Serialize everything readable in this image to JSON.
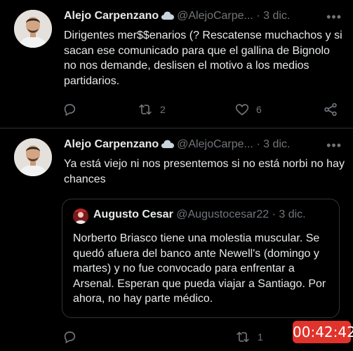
{
  "tweets": [
    {
      "author_name": "Alejo Carpenzano",
      "handle": "@AlejoCarpe...",
      "time": "· 3 dic.",
      "text": "Dirigentes mer$$enarios (? Rescatense muchachos y si sacan ese comunicado para que el gallina de Bignolo no nos demande, deslisen el motivo a los medios partidarios.",
      "retweets": "2",
      "likes": "6"
    },
    {
      "author_name": "Alejo Carpenzano",
      "handle": "@AlejoCarpe...",
      "time": "· 3 dic.",
      "text": "Ya está viejo ni nos presentemos si no está norbi no hay chances",
      "quote": {
        "author_name": "Augusto Cesar",
        "handle": "@Augustocesar22",
        "time": "· 3 dic.",
        "text": "Norberto Briasco tiene una molestia muscular. Se quedó afuera del banco ante Newell's (domingo y martes) y no fue convocado para enfrentar a Arsenal. Esperan que pueda viajar a Santiago. Por ahora, no hay parte médico."
      },
      "retweets": "1"
    }
  ],
  "overlay": {
    "timer": "00:42:42",
    "timer_color": "#e0332c"
  },
  "colors": {
    "background": "#000000",
    "text": "#e7e9ea",
    "muted": "#71767b",
    "border": "#2f3336"
  },
  "icons": [
    "cloud-icon",
    "more-icon",
    "reply-icon",
    "retweet-icon",
    "like-icon",
    "share-icon"
  ]
}
